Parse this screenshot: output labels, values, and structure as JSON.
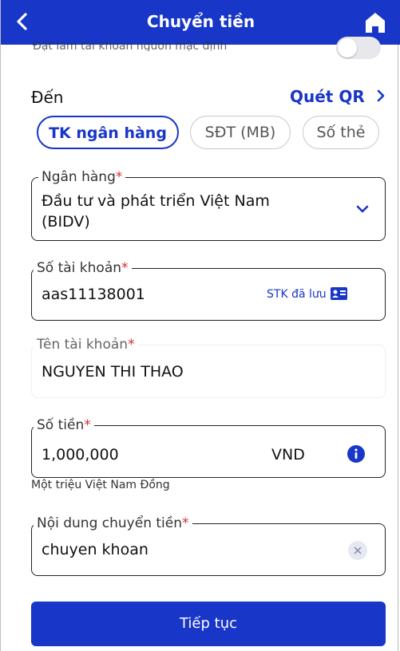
{
  "header": {
    "title": "Chuyển tiền"
  },
  "source_option": {
    "hidden_text": "Đặt làm tài khoản nguồn mặc định"
  },
  "destination": {
    "label": "Đến",
    "qr_label": "Quét QR",
    "qr_chevron": "›"
  },
  "tabs": [
    {
      "label": "TK ngân hàng"
    },
    {
      "label": "SĐT (MB)"
    },
    {
      "label": "Số thẻ"
    }
  ],
  "bank_field": {
    "label": "Ngân hàng",
    "required": "*",
    "value_line1": "Đầu tư và phát triển Việt Nam",
    "value_line2": "(BIDV)"
  },
  "account_field": {
    "label": "Số tài khoản",
    "required": "*",
    "value": "aas11138001",
    "saved_label": "STK đã lưu"
  },
  "name_field": {
    "label": "Tên tài khoản",
    "required": "*",
    "value": "NGUYEN THI THAO"
  },
  "amount_field": {
    "label": "Số tiền",
    "required": "*",
    "value": "1,000,000",
    "currency": "VND",
    "in_words": "Một triệu Việt Nam Đồng"
  },
  "content_field": {
    "label": "Nội dung chuyển tiền",
    "required": "*",
    "value": "chuyen khoan"
  },
  "continue_button": {
    "label": "Tiếp tục"
  },
  "colors": {
    "primary": "#1836c8",
    "required": "#d32f2f"
  }
}
